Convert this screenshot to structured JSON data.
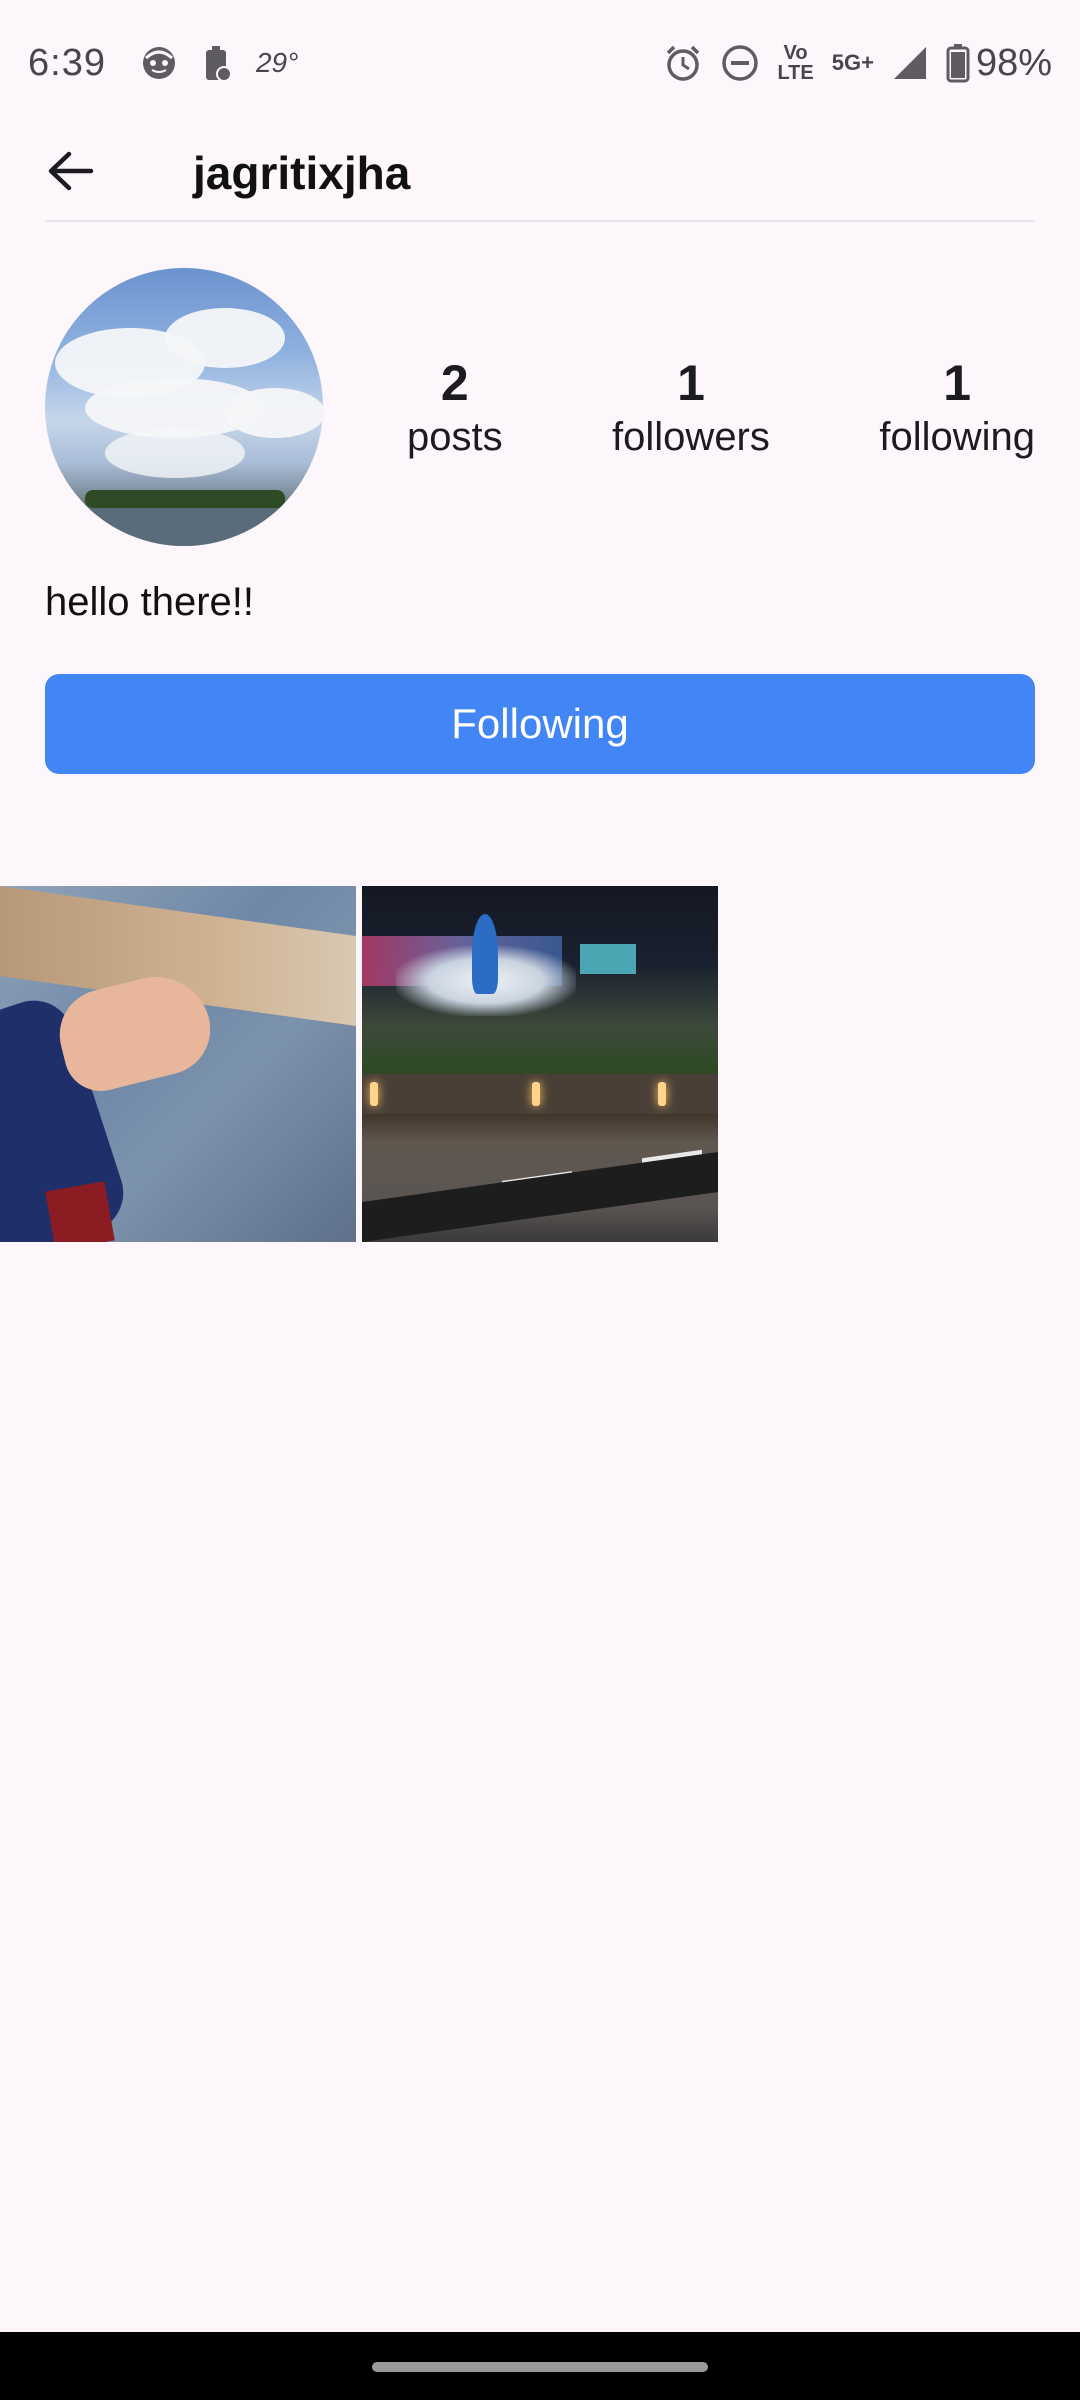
{
  "status_bar": {
    "time": "6:39",
    "temperature": "29°",
    "network_top": "Vo",
    "network_bottom": "LTE",
    "signal_type": "5G+",
    "battery_percent": "98%"
  },
  "app_bar": {
    "username": "jagritixjha",
    "back_icon": "arrow-left-icon"
  },
  "profile": {
    "avatar_description": "sky-with-clouds",
    "stats": [
      {
        "count": "2",
        "label": "posts"
      },
      {
        "count": "1",
        "label": "followers"
      },
      {
        "count": "1",
        "label": "following"
      }
    ],
    "bio": "hello there!!"
  },
  "follow_button": {
    "label": "Following",
    "color": "#4285f4"
  },
  "posts": [
    {
      "id": "post-1",
      "subject": "hand on denim shirt"
    },
    {
      "id": "post-2",
      "subject": "night fountain"
    }
  ],
  "theme": {
    "background": "#fdf7fc",
    "accent": "#4285f4"
  }
}
